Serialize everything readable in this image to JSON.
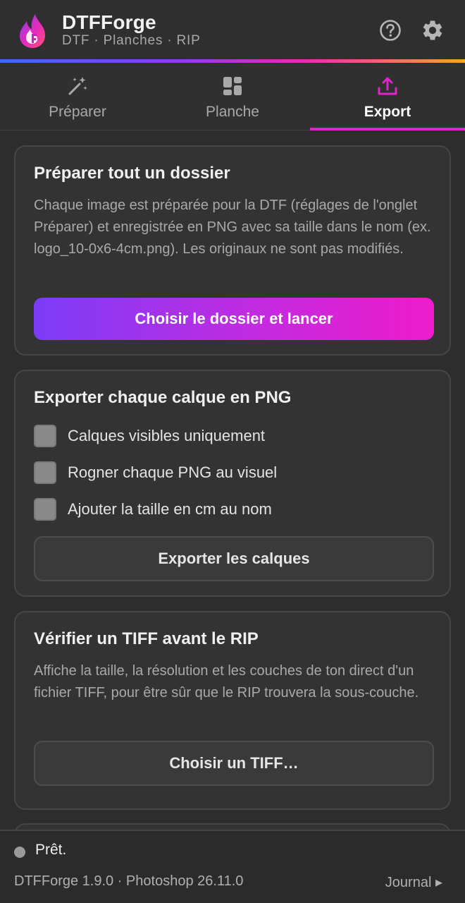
{
  "header": {
    "title": "DTFForge",
    "subtitle": "DTF · Planches · RIP",
    "help_icon": "question-circle-icon",
    "settings_icon": "gear-icon"
  },
  "colors": {
    "accent_pink": "#e025c8",
    "accent_purple": "#7b3cf7",
    "background": "#2d2d2d",
    "card": "#333333"
  },
  "tabs": [
    {
      "label": "Préparer",
      "icon": "magic-wand-icon",
      "active": false
    },
    {
      "label": "Planche",
      "icon": "layout-grid-icon",
      "active": false
    },
    {
      "label": "Export",
      "icon": "upload-icon",
      "active": true
    }
  ],
  "batch_card": {
    "title": "Préparer tout un dossier",
    "description": "Chaque image est préparée pour la DTF (réglages de l'onglet Préparer) et enregistrée en PNG avec sa taille dans le nom (ex. logo_10-0x6-4cm.png). Les originaux ne sont pas modifiés.",
    "button_label": "Choisir le dossier et lancer"
  },
  "layers_card": {
    "title": "Exporter chaque calque en PNG",
    "options": [
      {
        "label": "Calques visibles uniquement",
        "checked": false
      },
      {
        "label": "Rogner chaque PNG au visuel",
        "checked": false
      },
      {
        "label": "Ajouter la taille en cm au nom",
        "checked": false
      }
    ],
    "button_label": "Exporter les calques"
  },
  "tiff_card": {
    "title": "Vérifier un TIFF avant le RIP",
    "description": "Affiche la taille, la résolution et les couches de ton direct d'un fichier TIFF, pour être sûr que le RIP trouvera la sous-couche.",
    "button_label": "Choisir un TIFF…"
  },
  "footer": {
    "status": "Prêt.",
    "version": "DTFForge 1.9.0 · Photoshop 26.11.0",
    "journal_link": "Journal ▸"
  }
}
